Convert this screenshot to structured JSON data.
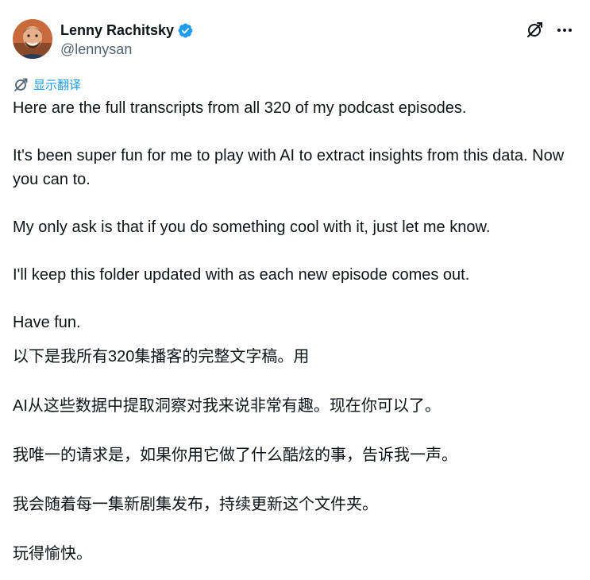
{
  "author": {
    "display_name": "Lenny Rachitsky",
    "handle": "@lennysan",
    "verified": true,
    "avatar_icon": "avatar-photo"
  },
  "header_actions": {
    "grok_icon": "grok-slash-circle-icon",
    "more_icon": "more-horizontal-icon"
  },
  "translate": {
    "label": "显示翻译",
    "icon": "translate-globe-icon"
  },
  "tweet": {
    "paragraphs": [
      "Here are the full transcripts from all 320 of my podcast episodes.",
      "It's been super fun for me to play with AI to extract insights from this data. Now you can to.",
      "My only ask is that if you do something cool with it, just let me know.",
      "I'll keep this folder updated with as each new episode comes out.",
      "Have fun."
    ]
  },
  "translation": {
    "paragraphs": [
      "以下是我所有320集播客的完整文字稿。用",
      "AI从这些数据中提取洞察对我来说非常有趣。现在你可以了。",
      "我唯一的请求是，如果你用它做了什么酷炫的事，告诉我一声。",
      "我会随着每一集新剧集发布，持续更新这个文件夹。",
      "玩得愉快。"
    ]
  },
  "colors": {
    "text": "#0f1419",
    "secondary": "#536471",
    "accent": "#1d9bf0"
  }
}
